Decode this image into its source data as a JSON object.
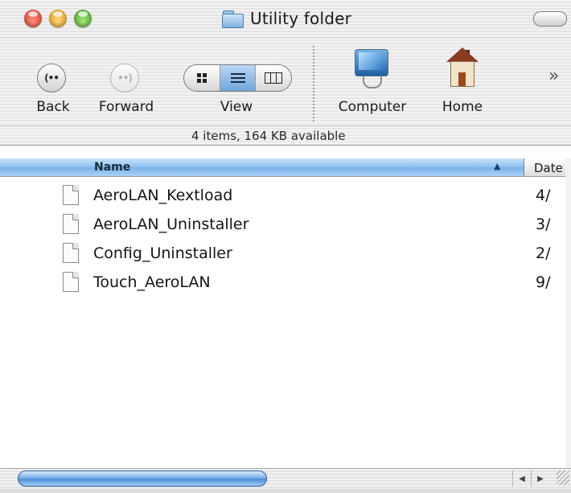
{
  "window": {
    "title": "Utility folder"
  },
  "toolbar": {
    "back_label": "Back",
    "forward_label": "Forward",
    "view_label": "View",
    "computer_label": "Computer",
    "home_label": "Home",
    "overflow_glyph": "»",
    "view_modes": [
      "icon",
      "list",
      "column"
    ],
    "active_view": "list"
  },
  "status": {
    "text": "4 items, 164 KB available"
  },
  "columns": {
    "name": "Name",
    "date": "Date"
  },
  "files": [
    {
      "name": "AeroLAN_Kextload",
      "date": "4/"
    },
    {
      "name": "AeroLAN_Uninstaller",
      "date": "3/"
    },
    {
      "name": "Config_Uninstaller",
      "date": "2/"
    },
    {
      "name": "Touch_AeroLAN",
      "date": "9/"
    }
  ],
  "colors": {
    "selection_blue": "#79b1e9",
    "close": "#d9361f",
    "minimize": "#e08e0b",
    "zoom": "#3c9c1d"
  }
}
